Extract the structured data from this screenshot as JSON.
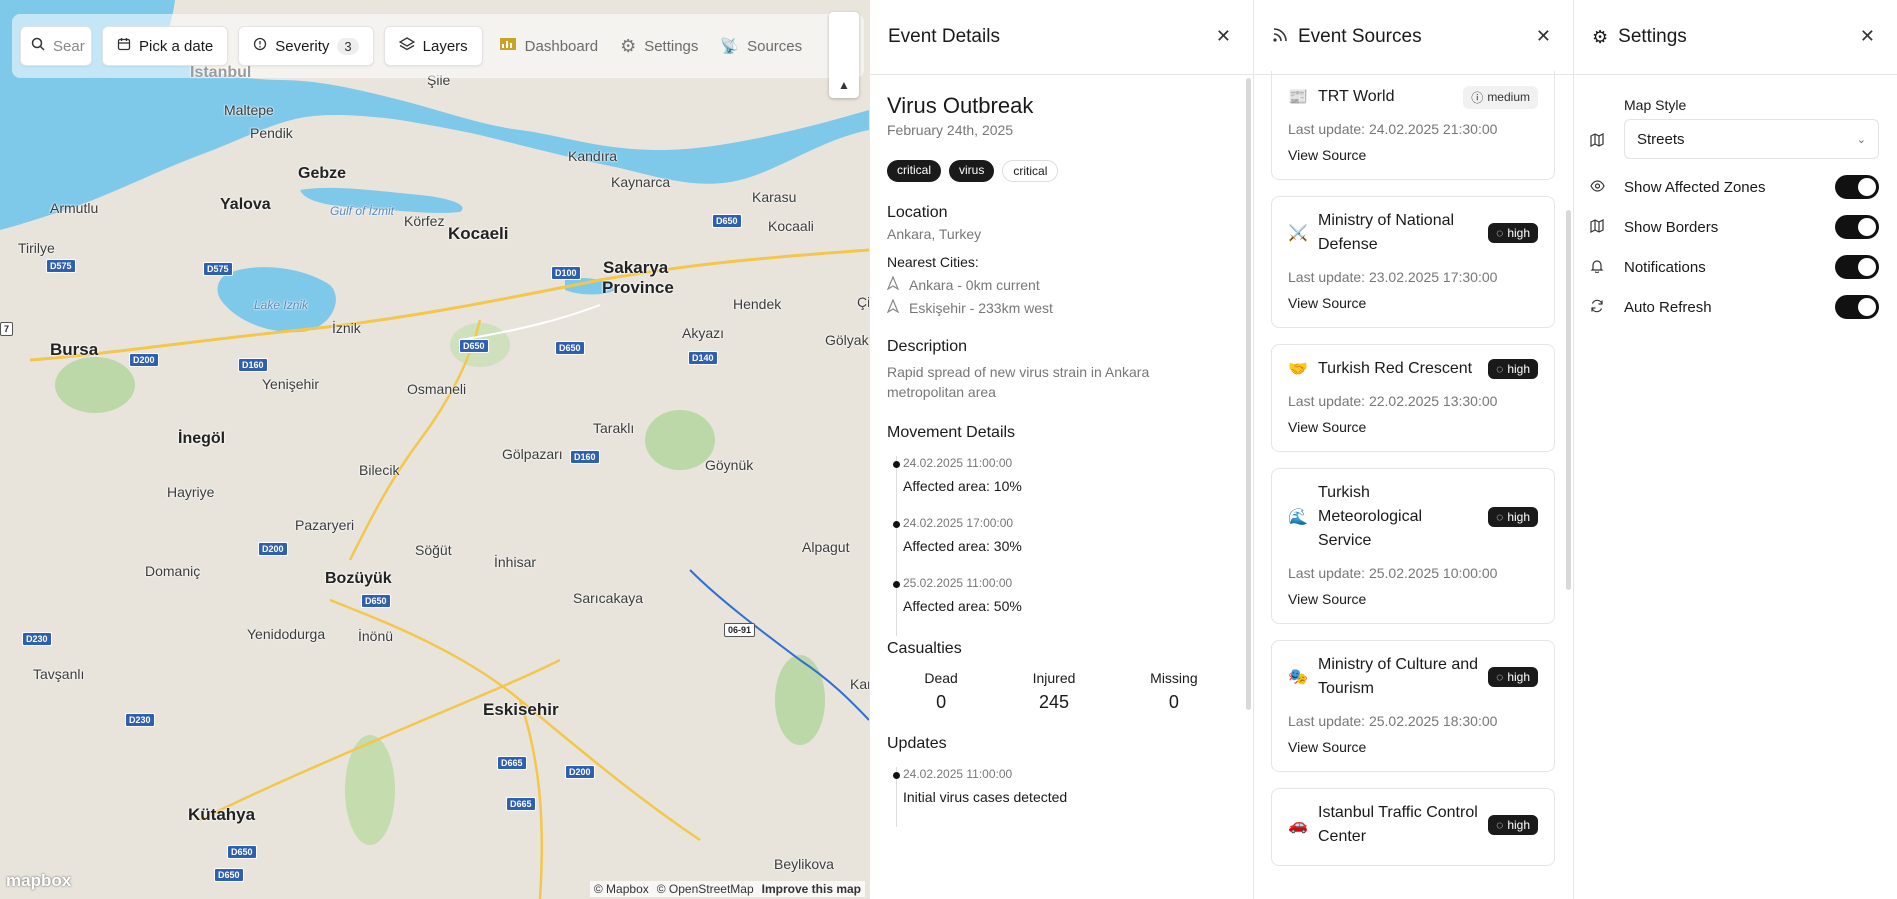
{
  "toolbar": {
    "search_placeholder": "Sear",
    "date_label": "Pick a date",
    "severity_label": "Severity",
    "severity_count": "3",
    "layers_label": "Layers",
    "dashboard_label": "Dashboard",
    "settings_label": "Settings",
    "sources_label": "Sources"
  },
  "map": {
    "labels": {
      "istanbul": "Istanbul",
      "sile": "Şile",
      "maltepe": "Maltepe",
      "pendik": "Pendik",
      "gebze": "Gebze",
      "kandira": "Kandıra",
      "kaynarca": "Kaynarca",
      "karasu": "Karasu",
      "yalova": "Yalova",
      "armutlu": "Armutlu",
      "gulf": "Gulf of İzmit",
      "korfez": "Körfez",
      "kocaeli": "Kocaeli",
      "kocaali": "Kocaali",
      "tirilye": "Tirilye",
      "sakarya": "Sakarya",
      "province": "Province",
      "hendek": "Hendek",
      "lake_iznik": "Lake Iznik",
      "iznik": "İznik",
      "akyazi": "Akyazı",
      "golyaka": "Gölyaka",
      "bursa": "Bursa",
      "yenisehir": "Yenişehir",
      "osmaneli": "Osmaneli",
      "tarakli": "Taraklı",
      "inegol": "İnegöl",
      "bilecik": "Bilecik",
      "golpazari": "Gölpazarı",
      "goynuk": "Göynük",
      "hayriye": "Hayriye",
      "pazaryeri": "Pazaryeri",
      "sogut": "Söğüt",
      "inhisar": "İnhisar",
      "alpagut": "Alpagut",
      "domanic": "Domaniç",
      "bozuyuk": "Bozüyük",
      "saricakaya": "Sarıcakaya",
      "yenidodurga": "Yenidodurga",
      "inonu": "İnönü",
      "tavsanli": "Tavşanlı",
      "eskisehir": "Eskisehir",
      "kutahya": "Kütahya",
      "beylikova": "Beylikova",
      "kar": "Kar",
      "ci": "Çi"
    },
    "roads": [
      "D575",
      "D575",
      "D100",
      "D650",
      "D200",
      "D160",
      "D650",
      "D650",
      "D140",
      "D160",
      "D200",
      "D650",
      "D230",
      "06-91",
      "D230",
      "D665",
      "D200",
      "D665",
      "D650",
      "D650",
      "7"
    ],
    "logo": "mapbox",
    "attribution": [
      "© Mapbox",
      "© OpenStreetMap",
      "Improve this map"
    ]
  },
  "details": {
    "header": "Event Details",
    "title": "Virus Outbreak",
    "date": "February 24th, 2025",
    "tags": [
      "critical",
      "virus",
      "critical"
    ],
    "location_title": "Location",
    "location": "Ankara, Turkey",
    "nearest_title": "Nearest Cities:",
    "nearest": [
      "Ankara - 0km current",
      "Eskişehir - 233km west"
    ],
    "description_title": "Description",
    "description": "Rapid spread of new virus strain in Ankara metropolitan area",
    "movement_title": "Movement Details",
    "movements": [
      {
        "time": "24.02.2025 11:00:00",
        "text": "Affected area: 10%"
      },
      {
        "time": "24.02.2025 17:00:00",
        "text": "Affected area: 30%"
      },
      {
        "time": "25.02.2025 11:00:00",
        "text": "Affected area: 50%"
      }
    ],
    "casualties_title": "Casualties",
    "casualties": [
      {
        "label": "Dead",
        "value": "0"
      },
      {
        "label": "Injured",
        "value": "245"
      },
      {
        "label": "Missing",
        "value": "0"
      }
    ],
    "updates_title": "Updates",
    "updates": [
      {
        "time": "24.02.2025 11:00:00",
        "text": "Initial virus cases detected"
      }
    ]
  },
  "sources": {
    "header": "Event Sources",
    "items": [
      {
        "icon": "📰",
        "name": "TRT World",
        "severity": "medium",
        "update": "Last update: 24.02.2025 21:30:00",
        "link": "View Source"
      },
      {
        "icon": "⚔️",
        "name": "Ministry of National Defense",
        "severity": "high",
        "update": "Last update: 23.02.2025 17:30:00",
        "link": "View Source"
      },
      {
        "icon": "🤝",
        "name": "Turkish Red Crescent",
        "severity": "high",
        "update": "Last update: 22.02.2025 13:30:00",
        "link": "View Source"
      },
      {
        "icon": "🌊",
        "name": "Turkish Meteorological Service",
        "severity": "high",
        "update": "Last update: 25.02.2025 10:00:00",
        "link": "View Source"
      },
      {
        "icon": "🎭",
        "name": "Ministry of Culture and Tourism",
        "severity": "high",
        "update": "Last update: 25.02.2025 18:30:00",
        "link": "View Source"
      },
      {
        "icon": "🚗",
        "name": "Istanbul Traffic Control Center",
        "severity": "high",
        "update": "",
        "link": ""
      }
    ]
  },
  "settings": {
    "header": "Settings",
    "map_style_label": "Map Style",
    "map_style_value": "Streets",
    "toggles": [
      {
        "label": "Show Affected Zones",
        "icon": "eye-icon",
        "on": true
      },
      {
        "label": "Show Borders",
        "icon": "map-icon",
        "on": true
      },
      {
        "label": "Notifications",
        "icon": "bell-icon",
        "on": true
      },
      {
        "label": "Auto Refresh",
        "icon": "refresh-icon",
        "on": true
      }
    ]
  }
}
